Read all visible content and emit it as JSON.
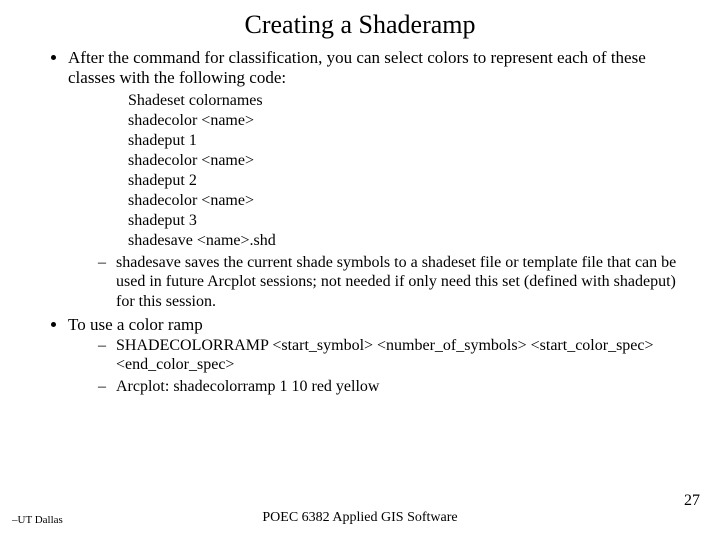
{
  "title": "Creating a  Shaderamp",
  "bullets": {
    "b1": "After the command for classification, you can select colors to represent each of these classes with the following code:",
    "code": {
      "l1": "Shadeset colornames",
      "l2": "shadecolor <name>",
      "l3": "shadeput 1",
      "l4": "shadecolor <name>",
      "l5": "shadeput 2",
      "l6": "shadecolor <name>",
      "l7": "shadeput 3",
      "l8": "shadesave <name>.shd"
    },
    "b1_sub1": "shadesave saves the current shade symbols to a shadeset file or template file that can be used in future Arcplot sessions; not needed if only need this set (defined with shadeput) for this session.",
    "b2": "To use a color ramp",
    "b2_sub1": "SHADECOLORRAMP <start_symbol> <number_of_symbols> <start_color_spec> <end_color_spec>",
    "b2_sub2": "Arcplot:  shadecolorramp 1 10 red yellow"
  },
  "footer": {
    "left": "–UT Dallas",
    "center": "POEC 6382 Applied GIS Software",
    "page": "27"
  }
}
